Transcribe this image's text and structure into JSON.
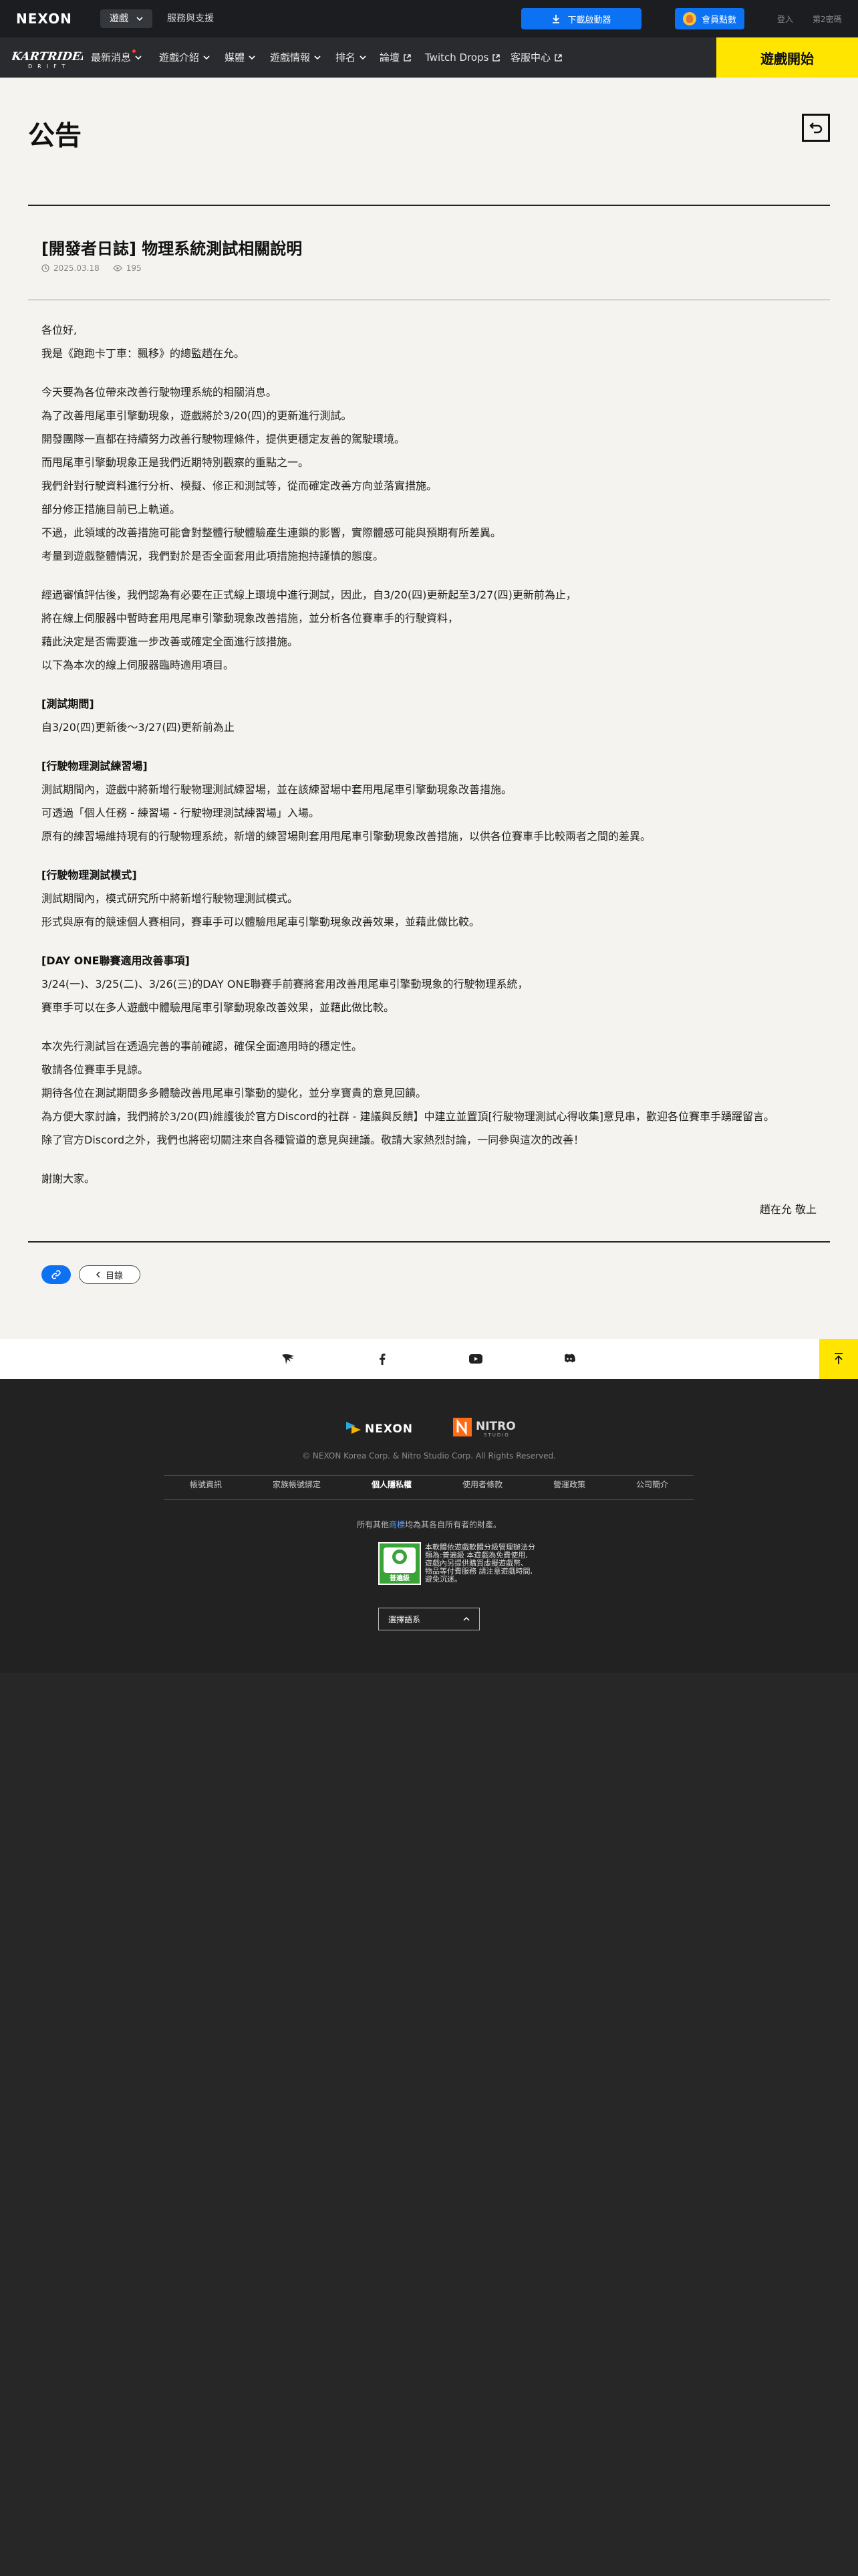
{
  "topbar": {
    "brand": "NEXON",
    "nav": [
      {
        "label": "遊戲",
        "active": true,
        "has_dropdown": true
      },
      {
        "label": "服務與支援",
        "active": false,
        "has_dropdown": false
      }
    ],
    "download_label": "下載啟動器",
    "member_label": "會員點數",
    "login_label": "登入",
    "secondary_label": "第2密碼"
  },
  "gamenav": {
    "logo_text": "KARTRIDER",
    "logo_sub": "DRIFT",
    "items": [
      {
        "label": "最新消息",
        "icon": "chevron-down-icon",
        "badge": true
      },
      {
        "label": "遊戲介紹",
        "icon": "chevron-down-icon"
      },
      {
        "label": "媒體",
        "icon": "chevron-down-icon"
      },
      {
        "label": "遊戲情報",
        "icon": "chevron-down-icon"
      },
      {
        "label": "排名",
        "icon": "chevron-down-icon"
      },
      {
        "label": "論壇",
        "icon": "external-link-icon"
      },
      {
        "label": "Twitch Drops",
        "icon": "external-link-icon"
      },
      {
        "label": "客服中心",
        "icon": "external-link-icon"
      }
    ],
    "play_label": "遊戲開始"
  },
  "page": {
    "title": "公告",
    "back_icon": "return-icon"
  },
  "article": {
    "title": "[開發者日誌] 物理系統測試相關說明",
    "date": "2025.03.18",
    "views": "195",
    "body": {
      "l1": "各位好,",
      "l2": "我是《跑跑卡丁車：飄移》的總監趙在允。",
      "l3": "今天要為各位帶來改善行駛物理系統的相關消息。",
      "l4": "為了改善甩尾車引擎動現象，遊戲將於3/20(四)的更新進行測試。",
      "l5": "開發團隊一直都在持續努力改善行駛物理條件，提供更穩定友善的駕駛環境。",
      "l6": "而甩尾車引擎動現象正是我們近期特別觀察的重點之一。",
      "l7": "我們針對行駛資料進行分析、模擬、修正和測試等，從而確定改善方向並落實措施。",
      "l8": "部分修正措施目前已上軌道。",
      "l9": "不過，此領域的改善措施可能會對整體行駛體驗產生連鎖的影響，實際體感可能與預期有所差異。",
      "l10": "考量到遊戲整體情況，我們對於是否全面套用此項措施抱持謹慎的態度。",
      "l11": "經過審慎評估後，我們認為有必要在正式線上環境中進行測試，因此，自3/20(四)更新起至3/27(四)更新前為止，",
      "l12": "將在線上伺服器中暫時套用甩尾車引擎動現象改善措施，並分析各位賽車手的行駛資料，",
      "l13": "藉此決定是否需要進一步改善或確定全面進行該措施。",
      "l14": "以下為本次的線上伺服器臨時適用項目。",
      "h1": "[測試期間]",
      "l15": "自3/20(四)更新後～3/27(四)更新前為止",
      "h2": "[行駛物理測試練習場]",
      "l16": "測試期間內，遊戲中將新增行駛物理測試練習場，並在該練習場中套用甩尾車引擎動現象改善措施。",
      "l17": "可透過「個人任務 - 練習場 - 行駛物理測試練習場」入場。",
      "l18": "原有的練習場維持現有的行駛物理系統，新增的練習場則套用甩尾車引擎動現象改善措施，以供各位賽車手比較兩者之間的差異。",
      "h3": "[行駛物理測試模式]",
      "l19": "測試期間內，模式研究所中將新增行駛物理測試模式。",
      "l20": "形式與原有的競速個人賽相同，賽車手可以體驗甩尾車引擎動現象改善效果，並藉此做比較。",
      "h4": "[DAY ONE聯賽適用改善事項]",
      "l21": "3/24(一)、3/25(二)、3/26(三)的DAY ONE聯賽手前賽將套用改善甩尾車引擎動現象的行駛物理系統，",
      "l22": "賽車手可以在多人遊戲中體驗甩尾車引擎動現象改善效果，並藉此做比較。",
      "l23": "本次先行測試旨在透過完善的事前確認，確保全面適用時的穩定性。",
      "l24": "敬請各位賽車手見諒。",
      "l25": "期待各位在測試期間多多體驗改善甩尾車引擎動的變化，並分享寶貴的意見回饋。",
      "l26": "為方便大家討論，我們將於3/20(四)維護後於官方Discord的社群 - 建議與反饋】中建立並置頂[行駛物理測試心得收集]意見串，歡迎各位賽車手踴躍留言。",
      "l27": "除了官方Discord之外，我們也將密切關注來自各種管道的意見與建議。敬請大家熱烈討論，一同參與這次的改善！",
      "l28": "謝謝大家。"
    },
    "signature": "趙在允 敬上",
    "list_label": "目錄"
  },
  "footer": {
    "copyright": "© NEXON Korea Corp. & Nitro Studio Corp. All Rights Reserved.",
    "links": [
      {
        "label": "帳號資訊",
        "strong": false
      },
      {
        "label": "家族帳號綁定",
        "strong": false
      },
      {
        "label": "個人隱私權",
        "strong": true
      },
      {
        "label": "使用者條款",
        "strong": false
      },
      {
        "label": "營運政策",
        "strong": false
      },
      {
        "label": "公司簡介",
        "strong": false
      }
    ],
    "notice_pre": "所有其他",
    "notice_hl": "商標",
    "notice_post": "均為其各自所有者的財產。",
    "rating_label": "普遍級",
    "rating_l1": "本軟體依遊戲軟體分級管理辦法分",
    "rating_l2": "類為:普遍級 本遊戲為免費使用,",
    "rating_l3": "遊戲內另提供購買虛擬遊戲幣、",
    "rating_l4": "物品等付費服務 請注意遊戲時間,",
    "rating_l5": "避免沉迷。",
    "language_label": "選擇語系"
  },
  "colors": {
    "accent_blue": "#0d72f2",
    "play_yellow": "#ffe500",
    "page_bg": "#f4f3ef",
    "footer_bg": "#222222"
  }
}
